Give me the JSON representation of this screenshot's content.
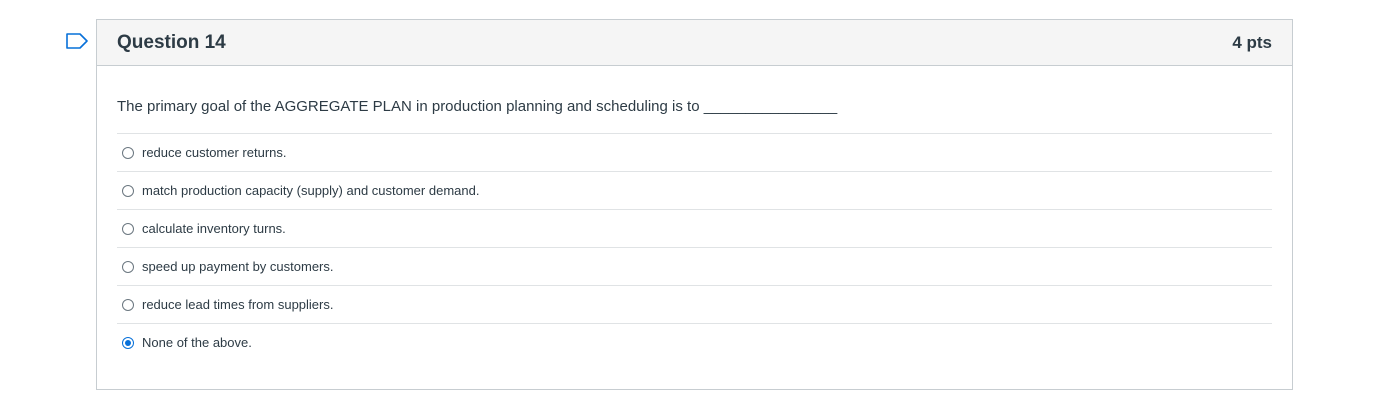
{
  "question": {
    "title": "Question 14",
    "points": "4 pts",
    "text": "The primary goal of the AGGREGATE PLAN in production planning and scheduling is to ________________",
    "flag_icon": "flag-icon",
    "answers": [
      {
        "label": "reduce customer returns.",
        "selected": false
      },
      {
        "label": "match production capacity (supply) and customer demand.",
        "selected": false
      },
      {
        "label": "calculate inventory turns.",
        "selected": false
      },
      {
        "label": "speed up payment by customers.",
        "selected": false
      },
      {
        "label": "reduce lead times from suppliers.",
        "selected": false
      },
      {
        "label": "None of the above.",
        "selected": true
      }
    ]
  },
  "colors": {
    "accent": "#0770d9",
    "text": "#2d3b45",
    "header_bg": "#f5f5f5",
    "border": "#c7cdd1"
  }
}
